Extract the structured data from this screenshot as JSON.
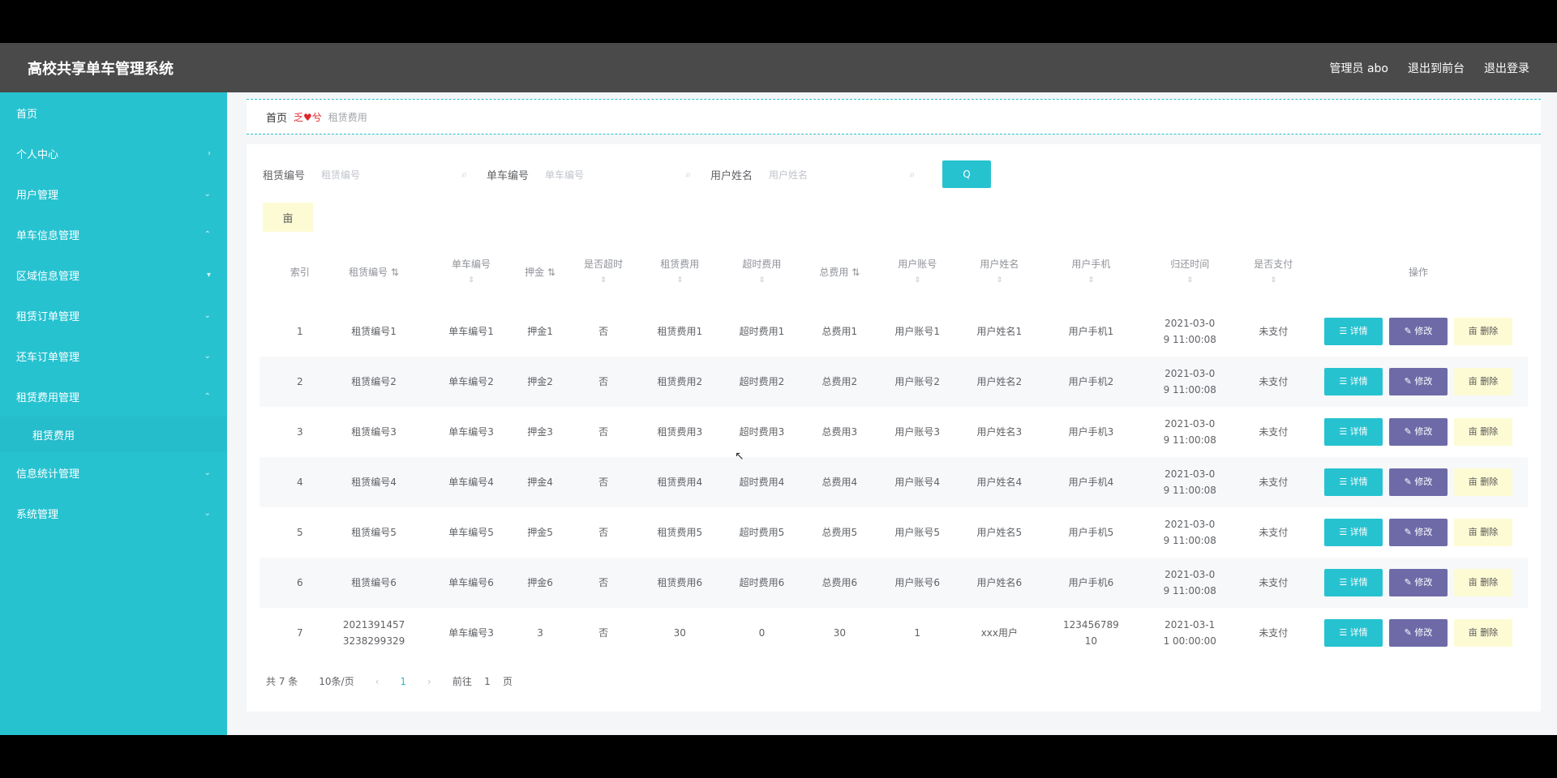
{
  "header": {
    "title": "高校共享单车管理系统",
    "admin": "管理员 abo",
    "to_front": "退出到前台",
    "logout": "退出登录"
  },
  "sidebar": {
    "items": [
      {
        "label": "首页",
        "arrow": ""
      },
      {
        "label": "个人中心",
        "arrow": "›"
      },
      {
        "label": "用户管理",
        "arrow": "⌄"
      },
      {
        "label": "单车信息管理",
        "arrow": "⌃"
      },
      {
        "label": "区域信息管理",
        "arrow": "▾"
      },
      {
        "label": "租赁订单管理",
        "arrow": "⌄"
      },
      {
        "label": "还车订单管理",
        "arrow": "⌄"
      },
      {
        "label": "租赁费用管理",
        "arrow": "⌃"
      }
    ],
    "sub_active": "租赁费用",
    "items_after": [
      {
        "label": "信息统计管理",
        "arrow": "⌄"
      },
      {
        "label": "系统管理",
        "arrow": "⌄"
      }
    ]
  },
  "breadcrumb": {
    "home": "首页",
    "sep": "乏♥兮",
    "current": "租赁费用"
  },
  "search": {
    "fields": [
      {
        "label": "租赁编号",
        "placeholder": "租赁编号"
      },
      {
        "label": "单车编号",
        "placeholder": "单车编号"
      },
      {
        "label": "用户姓名",
        "placeholder": "用户姓名"
      }
    ],
    "button": "Q",
    "delete": "亩"
  },
  "table": {
    "columns": [
      {
        "label": "",
        "sort": ""
      },
      {
        "label": "索引",
        "sort": ""
      },
      {
        "label": "租赁编号 ⇅",
        "sort": ""
      },
      {
        "label": "单车编号",
        "sort": "⇕"
      },
      {
        "label": "押金 ⇅",
        "sort": ""
      },
      {
        "label": "是否超时",
        "sort": "⇕"
      },
      {
        "label": "租赁费用",
        "sort": "⇕"
      },
      {
        "label": "超时费用",
        "sort": "⇕"
      },
      {
        "label": "总费用 ⇅",
        "sort": ""
      },
      {
        "label": "用户账号",
        "sort": "⇕"
      },
      {
        "label": "用户姓名",
        "sort": "⇕"
      },
      {
        "label": "用户手机",
        "sort": "⇕"
      },
      {
        "label": "归还时间",
        "sort": "⇕"
      },
      {
        "label": "是否支付",
        "sort": "⇕"
      },
      {
        "label": "操作",
        "sort": ""
      }
    ],
    "rows": [
      [
        "1",
        "租赁编号1",
        "单车编号1",
        "押金1",
        "否",
        "租赁费用1",
        "超时费用1",
        "总费用1",
        "用户账号1",
        "用户姓名1",
        "用户手机1",
        "2021-03-0\n9 11:00:08",
        "未支付"
      ],
      [
        "2",
        "租赁编号2",
        "单车编号2",
        "押金2",
        "否",
        "租赁费用2",
        "超时费用2",
        "总费用2",
        "用户账号2",
        "用户姓名2",
        "用户手机2",
        "2021-03-0\n9 11:00:08",
        "未支付"
      ],
      [
        "3",
        "租赁编号3",
        "单车编号3",
        "押金3",
        "否",
        "租赁费用3",
        "超时费用3",
        "总费用3",
        "用户账号3",
        "用户姓名3",
        "用户手机3",
        "2021-03-0\n9 11:00:08",
        "未支付"
      ],
      [
        "4",
        "租赁编号4",
        "单车编号4",
        "押金4",
        "否",
        "租赁费用4",
        "超时费用4",
        "总费用4",
        "用户账号4",
        "用户姓名4",
        "用户手机4",
        "2021-03-0\n9 11:00:08",
        "未支付"
      ],
      [
        "5",
        "租赁编号5",
        "单车编号5",
        "押金5",
        "否",
        "租赁费用5",
        "超时费用5",
        "总费用5",
        "用户账号5",
        "用户姓名5",
        "用户手机5",
        "2021-03-0\n9 11:00:08",
        "未支付"
      ],
      [
        "6",
        "租赁编号6",
        "单车编号6",
        "押金6",
        "否",
        "租赁费用6",
        "超时费用6",
        "总费用6",
        "用户账号6",
        "用户姓名6",
        "用户手机6",
        "2021-03-0\n9 11:00:08",
        "未支付"
      ],
      [
        "7",
        "2021391457\n3238299329",
        "单车编号3",
        "3",
        "否",
        "30",
        "0",
        "30",
        "1",
        "xxx用户",
        "123456789\n10",
        "2021-03-1\n1 00:00:00",
        "未支付"
      ]
    ],
    "ops": {
      "detail": "☰ 详情",
      "edit": "✎ 修改",
      "delete": "亩 删除"
    }
  },
  "pager": {
    "total": "共 7 条",
    "size": "10条/页",
    "prev": "‹",
    "page": "1",
    "next": "›",
    "goto": "前往",
    "goto_page": "1",
    "page_unit": "页"
  },
  "colors": {
    "accent": "#26c2d0",
    "header": "#4a4a4a",
    "edit": "#6d6aa7",
    "delete": "#fdfbd4"
  }
}
